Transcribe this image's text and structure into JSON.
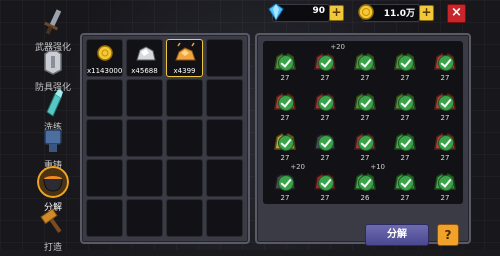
{
  "currency": {
    "gems": "90",
    "gold": "11.0万",
    "plus_label": "+"
  },
  "close_label": "×",
  "menu": [
    {
      "label": "武器强化",
      "icon": "sword-icon",
      "active": false
    },
    {
      "label": "防具强化",
      "icon": "armor-icon",
      "active": false
    },
    {
      "label": "洗练",
      "icon": "crystal-icon",
      "active": false
    },
    {
      "label": "重铸",
      "icon": "anvil-icon",
      "active": false
    },
    {
      "label": "分解",
      "icon": "cauldron-icon",
      "active": true
    },
    {
      "label": "打造",
      "icon": "hammer-icon",
      "active": false
    }
  ],
  "materials": [
    {
      "icon": "gold-coin-icon",
      "qty": "x1143000"
    },
    {
      "icon": "silver-ore-icon",
      "qty": "x45688"
    },
    {
      "icon": "orange-ore-icon",
      "qty": "x4399"
    }
  ],
  "gear_items": [
    {
      "level": "27",
      "plus": "",
      "icon": "green-helmet-icon"
    },
    {
      "level": "27",
      "plus": "+20",
      "icon": "red-armor-icon"
    },
    {
      "level": "27",
      "plus": "",
      "icon": "green-helmet-icon"
    },
    {
      "level": "27",
      "plus": "",
      "icon": "green-helmet-icon"
    },
    {
      "level": "27",
      "plus": "",
      "icon": "red-crown-icon"
    },
    {
      "level": "27",
      "plus": "",
      "icon": "red-crown-icon"
    },
    {
      "level": "27",
      "plus": "",
      "icon": "red-armor-icon"
    },
    {
      "level": "27",
      "plus": "",
      "icon": "green-helmet-icon"
    },
    {
      "level": "27",
      "plus": "",
      "icon": "green-helmet-icon"
    },
    {
      "level": "27",
      "plus": "",
      "icon": "red-crown-icon"
    },
    {
      "level": "27",
      "plus": "",
      "icon": "yellow-blade-icon"
    },
    {
      "level": "27",
      "plus": "",
      "icon": "dark-armor-icon"
    },
    {
      "level": "27",
      "plus": "",
      "icon": "red-armor-icon"
    },
    {
      "level": "27",
      "plus": "",
      "icon": "green-sword-icon"
    },
    {
      "level": "27",
      "plus": "",
      "icon": "red-crown-icon"
    },
    {
      "level": "27",
      "plus": "+20",
      "icon": "dark-armor-icon"
    },
    {
      "level": "27",
      "plus": "",
      "icon": "red-gauntlet-icon"
    },
    {
      "level": "26",
      "plus": "+10",
      "icon": "green-sword-icon"
    },
    {
      "level": "27",
      "plus": "",
      "icon": "green-sword-icon"
    },
    {
      "level": "27",
      "plus": "",
      "icon": "green-sword-icon"
    }
  ],
  "decompose_label": "分解",
  "help_label": "?"
}
